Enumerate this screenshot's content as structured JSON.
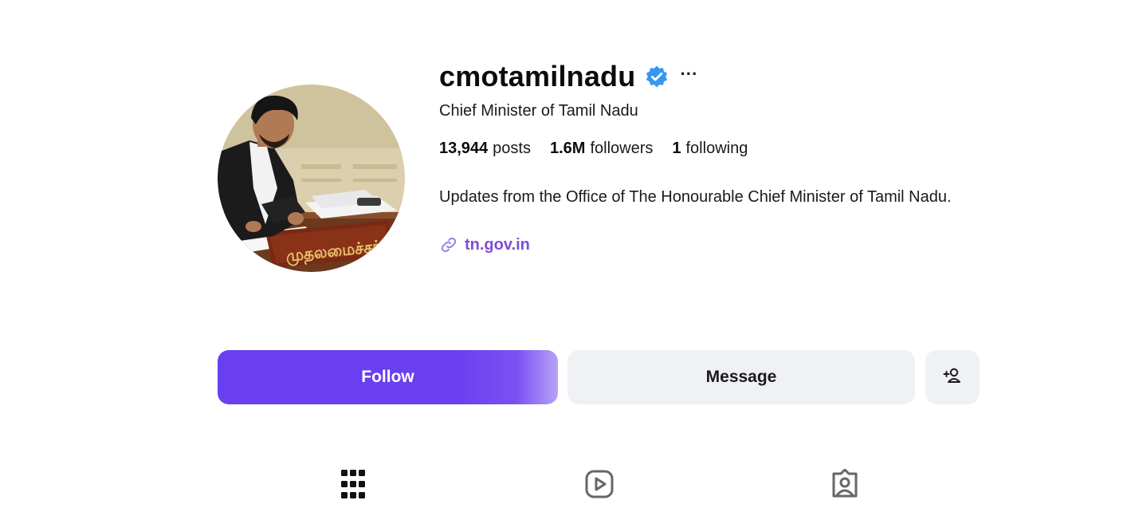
{
  "profile": {
    "username": "cmotamilnadu",
    "verified": true,
    "more_label": "···",
    "category": "Chief Minister of Tamil Nadu",
    "avatar_plaque_text": "முதலமைச்சர்"
  },
  "stats": {
    "posts": {
      "value": "13,944",
      "label": "posts"
    },
    "followers": {
      "value": "1.6M",
      "label": "followers"
    },
    "following": {
      "value": "1",
      "label": "following"
    }
  },
  "bio": {
    "text": "Updates from the Office of The Honourable Chief Minister of Tamil Nadu.",
    "link_text": "tn.gov.in"
  },
  "actions": {
    "follow_label": "Follow",
    "message_label": "Message",
    "suggest_icon": "add-person-icon"
  },
  "tabs": [
    {
      "icon": "grid-icon"
    },
    {
      "icon": "reels-icon"
    },
    {
      "icon": "tagged-icon"
    }
  ],
  "colors": {
    "follow_button": "#6a3ff0",
    "secondary_button": "#f0f1f5",
    "verified_badge": "#3897f0",
    "link": "#7c4fd9"
  }
}
